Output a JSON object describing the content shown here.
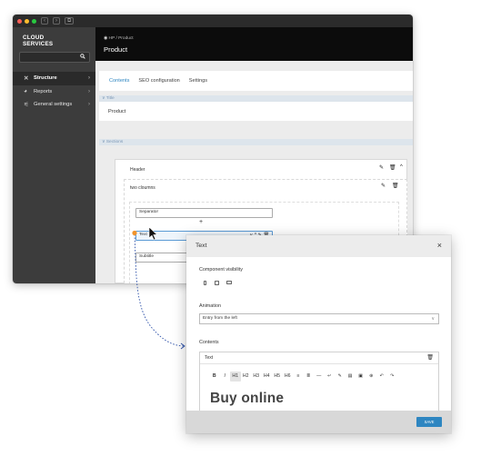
{
  "window": {
    "colors": {
      "close": "#ff5f57",
      "minimize": "#febc2e",
      "maximize": "#28c840"
    },
    "titlebar_buttons": [
      "‹",
      "›",
      "⧉"
    ]
  },
  "sidebar": {
    "brand_line1": "CLOUD",
    "brand_line2": "SERVICES",
    "search_icon": "magnifier-icon",
    "items": [
      {
        "label": "Structure",
        "icon": "✕",
        "active": true
      },
      {
        "label": "Reports",
        "icon": "◕",
        "active": false
      },
      {
        "label": "General settings",
        "icon": "⚟",
        "active": false
      }
    ]
  },
  "header": {
    "breadcrumb": "HP / Product",
    "title": "Product"
  },
  "tabs": {
    "contents": "Contents",
    "seo": "SEO configuration",
    "settings": "Settings"
  },
  "sections": {
    "title_label": "Title",
    "title_value": "Product",
    "sections_label": "Sections"
  },
  "blocks": {
    "header_label": "Header",
    "two_columns_label": "two cloumns",
    "separator_field": "Separator",
    "add_symbol": "+",
    "text_field": "Text",
    "subtitle_field": "Subtitle"
  },
  "modal": {
    "title": "Text",
    "close": "×",
    "visibility_label": "Component visibility",
    "animation_label": "Animation",
    "animation_value": "Entry from the left",
    "contents_label": "Contents",
    "editor_title": "Text",
    "toolbar": [
      "B",
      "I",
      "H1",
      "H2",
      "H3",
      "H4",
      "H5",
      "H6",
      "≡",
      "≣",
      "—",
      "↵",
      "✎",
      "▤",
      "▣",
      "⊕",
      "↶",
      "↷"
    ],
    "editor_text": "Buy online",
    "save": "SAVE"
  },
  "colors": {
    "accent": "#2e86c1",
    "dark": "#3c3c3c",
    "connector": "#2b4fa8",
    "handle": "#f0932b"
  }
}
